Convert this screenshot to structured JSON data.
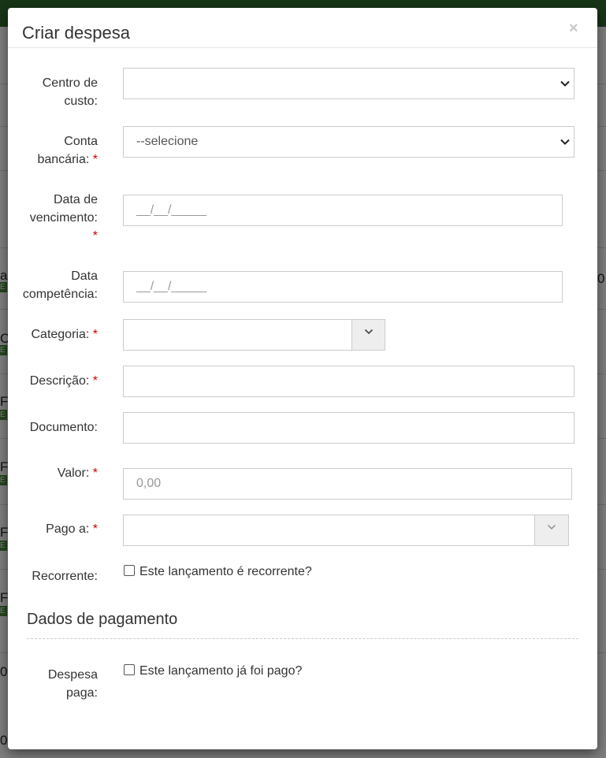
{
  "modal": {
    "title": "Criar despesa",
    "close_label": "×"
  },
  "form": {
    "cost_center": {
      "label_1": "Centro de",
      "label_2": "custo:",
      "value": ""
    },
    "bank_account": {
      "label_1": "Conta",
      "label_2": "bancária:",
      "required": "*",
      "value": "--selecione"
    },
    "due_date": {
      "label_1": "Data de",
      "label_2": "vencimento:",
      "required": "*",
      "placeholder": "__/__/_____"
    },
    "competence_date": {
      "label_1": "Data",
      "label_2": "competência:",
      "placeholder": "__/__/_____"
    },
    "category": {
      "label": "Categoria:",
      "required": "*",
      "value": ""
    },
    "description": {
      "label": "Descrição:",
      "required": "*",
      "value": ""
    },
    "document": {
      "label": "Documento:",
      "value": ""
    },
    "amount": {
      "label": "Valor:",
      "required": "*",
      "placeholder": "0,00"
    },
    "paid_to": {
      "label": "Pago a:",
      "required": "*",
      "value": ""
    },
    "recurring": {
      "label": "Recorrente:",
      "checkbox_label": "Este lançamento é recorrente?",
      "checked": false
    }
  },
  "payment_section": {
    "title": "Dados de pagamento",
    "paid": {
      "label_1": "Despesa",
      "label_2": "paga:",
      "checkbox_label": "Este lançamento já foi pago?",
      "checked": false
    }
  },
  "background": {
    "fragments": [
      "a",
      "0",
      "C",
      "FE",
      "FE",
      "FE",
      "FE",
      "0",
      "0"
    ],
    "tag_letter": "E"
  },
  "colors": {
    "topbar": "#2e6b2e",
    "required": "#cc0000",
    "border": "#cccccc",
    "addon_bg": "#eeeeee"
  },
  "icons": {
    "dropdown": "chevron-down-icon",
    "close": "close-icon"
  }
}
